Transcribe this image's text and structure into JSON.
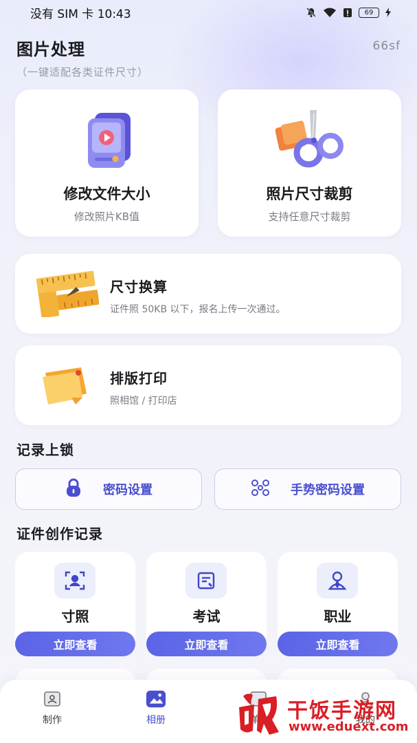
{
  "status": {
    "carrier": "没有 SIM 卡",
    "time": "10:43",
    "battery": "69"
  },
  "header": {
    "title": "图片处理",
    "subtitle": "（一键适配各类证件尺寸）",
    "user_code": "66sf"
  },
  "tools": [
    {
      "title": "修改文件大小",
      "sub": "修改照片KB值",
      "icon": "phone-video-icon"
    },
    {
      "title": "照片尺寸裁剪",
      "sub": "支持任意尺寸裁剪",
      "icon": "scissors-icon"
    },
    {
      "title": "尺寸换算",
      "sub": "证件照 50KB 以下，报名上传一次通过。",
      "icon": "ruler-icon"
    },
    {
      "title": "排版打印",
      "sub": "照相馆 / 打印店",
      "icon": "sticky-note-icon"
    }
  ],
  "lock_section": {
    "title": "记录上锁",
    "password_label": "密码设置",
    "gesture_label": "手势密码设置"
  },
  "records_section": {
    "title": "证件创作记录",
    "items": [
      {
        "label": "寸照",
        "button": "立即查看",
        "icon": "portrait-frame-icon"
      },
      {
        "label": "考试",
        "button": "立即查看",
        "icon": "exam-doc-icon"
      },
      {
        "label": "职业",
        "button": "立即查看",
        "icon": "professional-icon"
      }
    ]
  },
  "nav": {
    "items": [
      {
        "label": "制作"
      },
      {
        "label": "相册"
      },
      {
        "label": "样子"
      },
      {
        "label": "我的"
      }
    ]
  },
  "watermark": {
    "name": "干饭手游网",
    "url": "www.eduext.com"
  },
  "colors": {
    "accent": "#4a4fd0",
    "button": "#5a64e6",
    "watermark": "#d91f26"
  }
}
